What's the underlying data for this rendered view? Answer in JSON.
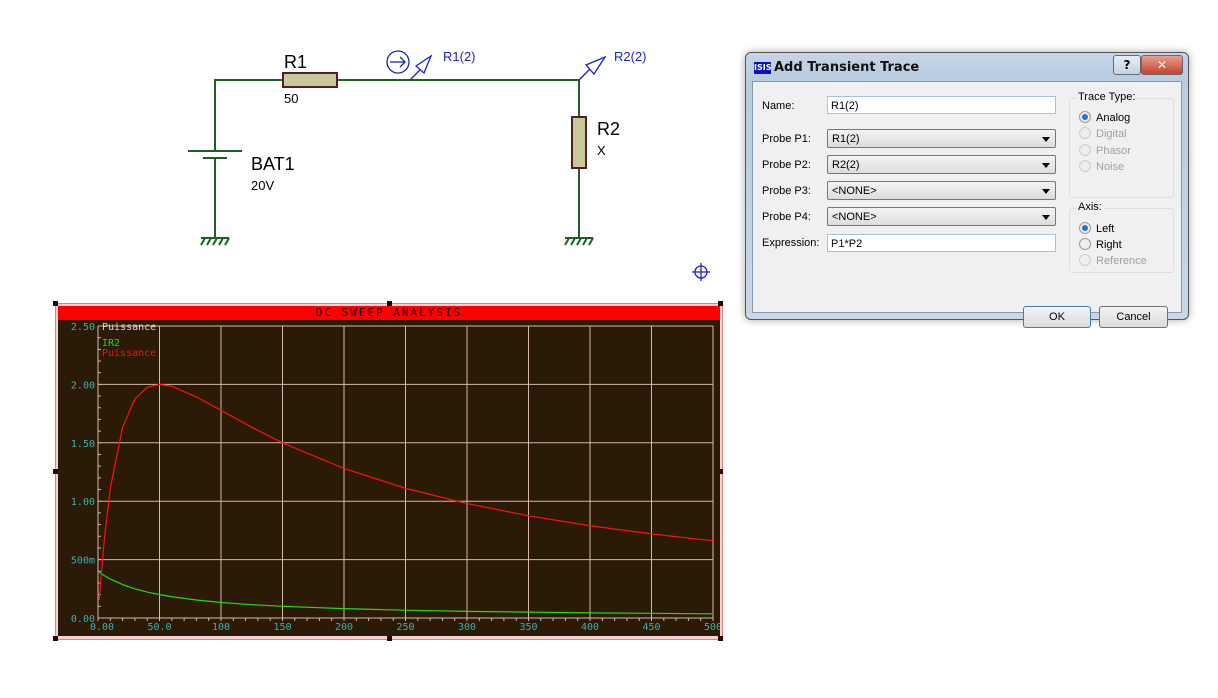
{
  "schematic": {
    "r1": {
      "name": "R1",
      "value": "50"
    },
    "r2": {
      "name": "R2",
      "value": "X"
    },
    "bat": {
      "name": "BAT1",
      "value": "20V"
    },
    "probes": [
      "R1(2)",
      "R2(2)"
    ],
    "wire_color": "#1f5f1f",
    "probe_color": "#2020c0"
  },
  "graph": {
    "title": "DC SWEEP ANALYSIS",
    "title_bg": "#ff0000",
    "plot_bg": "#2b1a05",
    "grid_color": "#d8b8b0"
  },
  "chart_data": {
    "type": "line",
    "title": "DC SWEEP ANALYSIS",
    "ylabel": "Puissance",
    "xlim": [
      0,
      500
    ],
    "ylim": [
      0,
      2.5
    ],
    "grid": true,
    "legend_placement": "top-left",
    "x_tick_labels": [
      "0.00",
      "50.0",
      "100",
      "150",
      "200",
      "250",
      "300",
      "350",
      "400",
      "450",
      "500"
    ],
    "y_tick_labels": [
      "0.00",
      "500m",
      "1.00",
      "1.50",
      "2.00",
      "2.50"
    ],
    "x": [
      1,
      5,
      10,
      20,
      30,
      40,
      50,
      60,
      80,
      100,
      125,
      150,
      200,
      250,
      300,
      350,
      400,
      450,
      500
    ],
    "series": [
      {
        "name": "IR2",
        "color": "#22dd00",
        "values": [
          0.392,
          0.364,
          0.333,
          0.286,
          0.25,
          0.222,
          0.2,
          0.182,
          0.154,
          0.133,
          0.114,
          0.1,
          0.08,
          0.067,
          0.057,
          0.05,
          0.044,
          0.04,
          0.036
        ]
      },
      {
        "name": "Puissance",
        "color": "#ff1010",
        "values": [
          0.154,
          0.661,
          1.111,
          1.633,
          1.875,
          1.975,
          2.0,
          1.983,
          1.893,
          1.778,
          1.633,
          1.5,
          1.28,
          1.111,
          0.98,
          0.875,
          0.79,
          0.72,
          0.661
        ]
      }
    ]
  },
  "dialog": {
    "title": "Add Transient Trace",
    "logo": "ISIS",
    "help": "?",
    "close": "✕",
    "name_label": "Name:",
    "name_value": "R1(2)",
    "probes": [
      {
        "label": "Probe P1:",
        "value": "R1(2)"
      },
      {
        "label": "Probe P2:",
        "value": "R2(2)"
      },
      {
        "label": "Probe P3:",
        "value": "<NONE>"
      },
      {
        "label": "Probe P4:",
        "value": "<NONE>"
      }
    ],
    "expression_label": "Expression:",
    "expression_value": "P1*P2",
    "trace_type_label": "Trace Type:",
    "trace_types": [
      "Analog",
      "Digital",
      "Phasor",
      "Noise"
    ],
    "trace_type_selected": "Analog",
    "axis_label": "Axis:",
    "axes": [
      "Left",
      "Right",
      "Reference"
    ],
    "axis_selected": "Left",
    "ok": "OK",
    "cancel": "Cancel"
  }
}
